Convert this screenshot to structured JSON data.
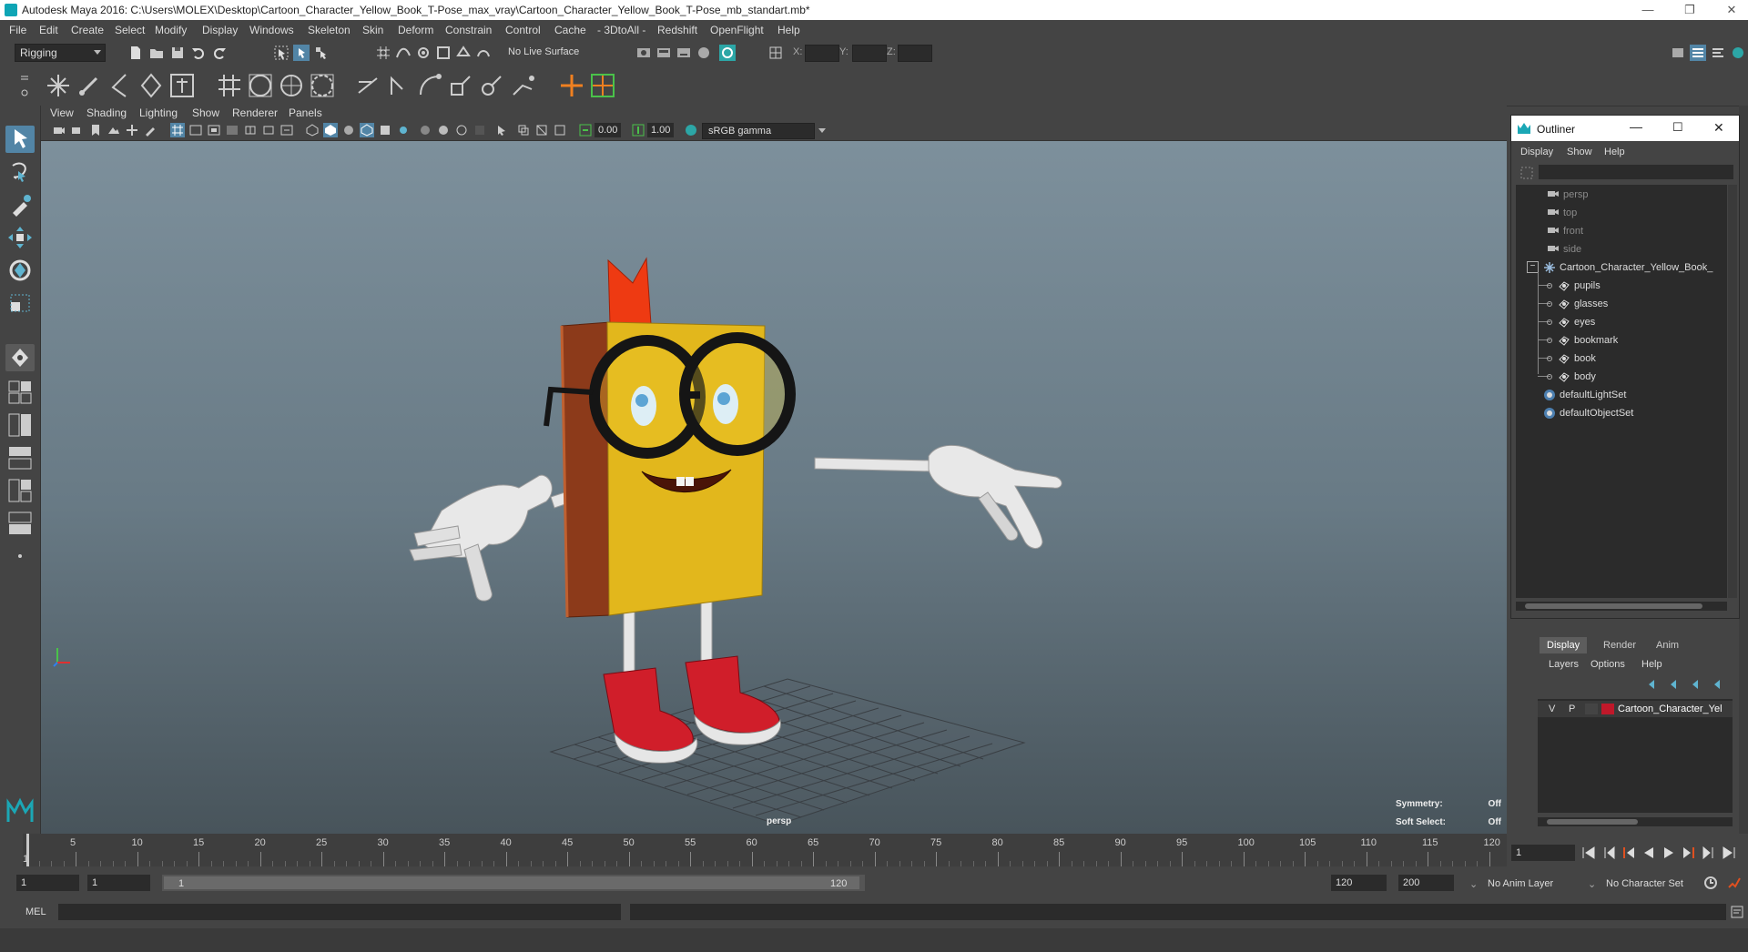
{
  "window": {
    "title": "Autodesk Maya 2016: C:\\Users\\MOLEX\\Desktop\\Cartoon_Character_Yellow_Book_T-Pose_max_vray\\Cartoon_Character_Yellow_Book_T-Pose_mb_standart.mb*",
    "minimize": "—",
    "restore": "❐",
    "close": "✕"
  },
  "menubar": [
    "File",
    "Edit",
    "Create",
    "Select",
    "Modify",
    "Display",
    "Windows",
    "Skeleton",
    "Skin",
    "Deform",
    "Constrain",
    "Control",
    "Cache",
    "- 3DtoAll -",
    "Redshift",
    "OpenFlight",
    "Help"
  ],
  "statusline": {
    "mode": "Rigging",
    "live_surface": "No Live Surface",
    "x_label": "X:",
    "y_label": "Y:",
    "z_label": "Z:"
  },
  "viewport": {
    "menu": [
      "View",
      "Shading",
      "Lighting",
      "Show",
      "Renderer",
      "Panels"
    ],
    "exposure": "0.00",
    "gamma": "1.00",
    "color_space": "sRGB gamma",
    "camera_label": "persp",
    "symmetry_label": "Symmetry:",
    "symmetry_value": "Off",
    "soft_select_label": "Soft Select:",
    "soft_select_value": "Off"
  },
  "outliner": {
    "title": "Outliner",
    "menu": [
      "Display",
      "Show",
      "Help"
    ],
    "items": [
      {
        "label": "persp",
        "type": "camera",
        "depth": 0,
        "dim": true
      },
      {
        "label": "top",
        "type": "camera",
        "depth": 0,
        "dim": true
      },
      {
        "label": "front",
        "type": "camera",
        "depth": 0,
        "dim": true
      },
      {
        "label": "side",
        "type": "camera",
        "depth": 0,
        "dim": true
      },
      {
        "label": "Cartoon_Character_Yellow_Book_",
        "type": "group",
        "depth": 0,
        "dim": false
      },
      {
        "label": "pupils",
        "type": "mesh",
        "depth": 1,
        "dim": false
      },
      {
        "label": "glasses",
        "type": "mesh",
        "depth": 1,
        "dim": false
      },
      {
        "label": "eyes",
        "type": "mesh",
        "depth": 1,
        "dim": false
      },
      {
        "label": "bookmark",
        "type": "mesh",
        "depth": 1,
        "dim": false
      },
      {
        "label": "book",
        "type": "mesh",
        "depth": 1,
        "dim": false
      },
      {
        "label": "body",
        "type": "mesh",
        "depth": 1,
        "dim": false
      },
      {
        "label": "defaultLightSet",
        "type": "set",
        "depth": 0,
        "dim": false
      },
      {
        "label": "defaultObjectSet",
        "type": "set",
        "depth": 0,
        "dim": false
      }
    ]
  },
  "layer_editor": {
    "tabs": [
      "Display",
      "Render",
      "Anim"
    ],
    "active_tab": "Display",
    "menu": [
      "Layers",
      "Options",
      "Help"
    ],
    "layer": {
      "v": "V",
      "p": "P",
      "name": "Cartoon_Character_Yel",
      "color": "#c0182a"
    }
  },
  "timeline": {
    "ticks": [
      "5",
      "10",
      "15",
      "20",
      "25",
      "30",
      "35",
      "40",
      "45",
      "50",
      "55",
      "60",
      "65",
      "70",
      "75",
      "80",
      "85",
      "90",
      "95",
      "100",
      "105",
      "110",
      "115",
      "120"
    ],
    "start_marker": "1",
    "current_frame": "1"
  },
  "range": {
    "start": "1",
    "playback_start": "1",
    "slider_start": "1",
    "slider_end": "120",
    "playback_end": "120",
    "end": "200",
    "anim_layer": "No Anim Layer",
    "character_set": "No Character Set"
  },
  "cmdline": {
    "label": "MEL"
  }
}
